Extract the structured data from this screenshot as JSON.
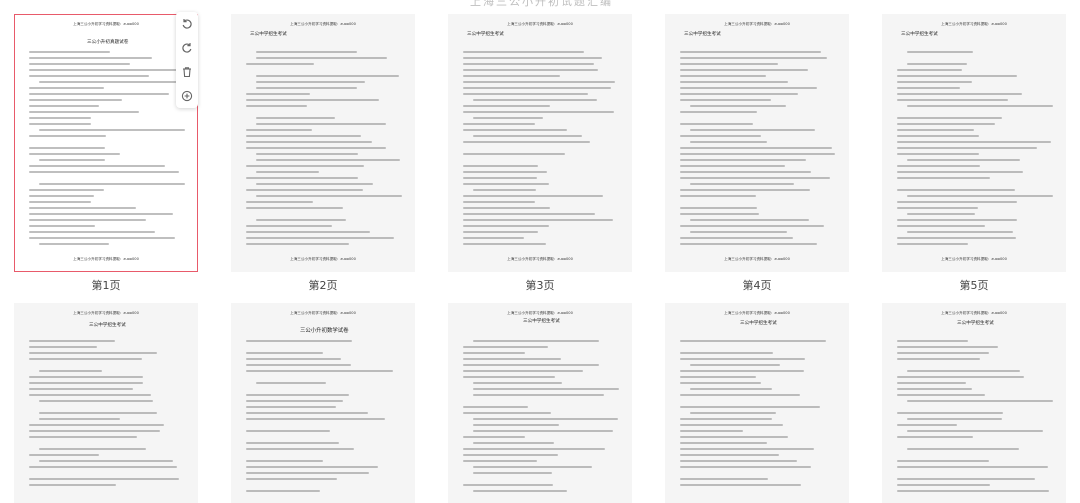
{
  "top_hint": "上海三公小升初试题汇编",
  "header_text": "上海三公小升初学习资料提取：zuoo000",
  "footer_text": "上海三公小升初学习资料提取：zuoo000",
  "toolbar": {
    "rotate_left": "rotate-left-icon",
    "rotate_right": "rotate-right-icon",
    "delete": "trash-icon",
    "insert": "add-icon"
  },
  "pages": [
    {
      "label": "第1页",
      "title": "三公小升初真题试卷",
      "selected": true
    },
    {
      "label": "第2页",
      "title": "三公中学招生考试",
      "selected": false
    },
    {
      "label": "第3页",
      "title": "三公中学招生考试",
      "selected": false
    },
    {
      "label": "第4页",
      "title": "三公中学招生考试",
      "selected": false
    },
    {
      "label": "第5页",
      "title": "三公中学招生考试",
      "selected": false
    },
    {
      "label": "",
      "title": "三公中学招生考试",
      "selected": false
    },
    {
      "label": "",
      "title": "三公小升初数学试卷",
      "selected": false
    },
    {
      "label": "",
      "title": "三公中学招生考试",
      "selected": false
    },
    {
      "label": "",
      "title": "三公中学招生考试",
      "selected": false
    },
    {
      "label": "",
      "title": "三公中学招生考试",
      "selected": false
    }
  ]
}
